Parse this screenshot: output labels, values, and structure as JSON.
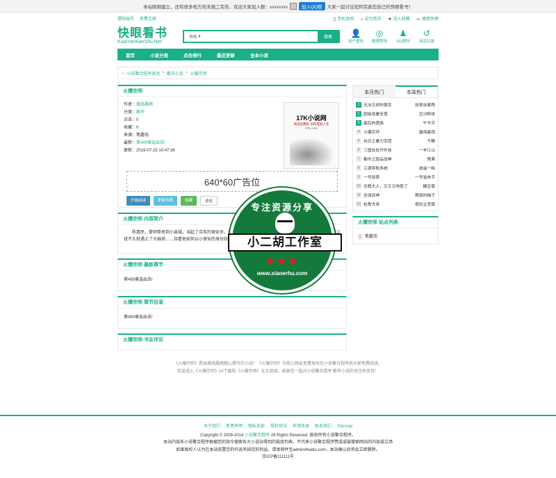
{
  "notice": {
    "text": "本站刚刚建立，还有很多地方尚未施工完毕，欢迎大家加入群：xxxxxxxx",
    "qq_button": "加入QQ群",
    "text2": "大家一起讨论如何完善您自己的快眼看书！"
  },
  "userbar": {
    "login": "登陆账号",
    "register": "免费注册",
    "mobile": "手机体验",
    "homepage": "设为首页",
    "favorite": "加入收藏",
    "desktop": "桌面快捷"
  },
  "logo": {
    "cn": "快眼看书",
    "en": "KuaiYanKanShu.Net"
  },
  "search": {
    "category": "书名",
    "button": "搜索",
    "value": ""
  },
  "header_icons": [
    {
      "icon": "user-icon",
      "glyph": "👤",
      "label": "用户登陆"
    },
    {
      "icon": "weibo-icon",
      "glyph": "◎",
      "label": "微博登陆"
    },
    {
      "icon": "qq-icon",
      "glyph": "♟",
      "label": "QQ登陆"
    },
    {
      "icon": "history-icon",
      "glyph": "↺",
      "label": "阅读记录"
    }
  ],
  "nav": [
    "首页",
    "小说分类",
    "点击排行",
    "最近更新",
    "全本小说"
  ],
  "breadcrumb": {
    "home": "小说聚合程序首页",
    "category": "都市小说",
    "book": "火爆宗师"
  },
  "book": {
    "title": "火爆宗师",
    "author_label": "作者：",
    "author": "瀚海晨雨",
    "category_label": "分类：",
    "category": "都市",
    "clicks_label": "点击：",
    "clicks": "0",
    "favorites_label": "收藏：",
    "favorites": "0",
    "source_label": "来源：",
    "source": "笔趣岛",
    "latest_label": "最新：",
    "latest": "第490章选出去!",
    "updated_label": "更新：",
    "updated": "2019-07-25 10:47:36",
    "cover": {
      "t1": "17K小说网",
      "t2": "阅读出精彩 创作成就人生",
      "t3": "17K.com"
    },
    "ad": "640*60广告位",
    "actions": [
      "开始阅读",
      "更新列表",
      "收藏",
      "评论"
    ]
  },
  "intro": {
    "title": "火爆宗师 内容简介",
    "text": "陈惠民，拳师牵来到小县城，当起了合库的保安员，想着每天混日子，无大亏损，本以为是个清闲的职务，不想上班不久就遇上了大麻烦……且看他如何以小保安的身份纷纷世间多彩……"
  },
  "latest_chapter": {
    "title": "火爆宗师 最新章节",
    "text": "第490章选出去!"
  },
  "chapter_list": {
    "title": "火爆宗师 章节目录",
    "text": "第490章选出去!"
  },
  "comments": {
    "title": "火爆宗师 书友评论"
  },
  "hot": {
    "tab_month": "本月热门",
    "tab_week": "本周热门",
    "items": [
      {
        "n": "1",
        "name": "无法忘却的誓恋",
        "author": "抚琴诉离殇"
      },
      {
        "n": "2",
        "name": "超级宠妻至尊",
        "author": "豆沙醉饼"
      },
      {
        "n": "3",
        "name": "最后的遗族",
        "author": "午木平"
      },
      {
        "n": "4",
        "name": "火爆宗师",
        "author": "瀚海晨雨"
      },
      {
        "n": "5",
        "name": "抗日之暴力军团",
        "author": "千鞭"
      },
      {
        "n": "6",
        "name": "三国处处开外挂",
        "author": "一丰江山"
      },
      {
        "n": "7",
        "name": "都市之超品战神",
        "author": "常果"
      },
      {
        "n": "8",
        "name": "江湖导航系统",
        "author": "逍遥一粕"
      },
      {
        "n": "9",
        "name": "一号狱首",
        "author": "一号狙击手"
      },
      {
        "n": "10",
        "name": "总裁大人，又又又吻我了",
        "author": "糖豆菊"
      },
      {
        "n": "11",
        "name": "全球武神",
        "author": "期滚的柚子"
      },
      {
        "n": "12",
        "name": "枯骨大帝",
        "author": "傍剑立苍蘖"
      }
    ]
  },
  "sites": {
    "title": "火爆宗师 站点列表",
    "items": [
      {
        "n": "1",
        "name": "笔趣岛"
      }
    ]
  },
  "description": {
    "line1": "《火爆宗师》是由瀚海晨雨精心撰写的小说！《火爆宗师》为热心网友免费发布在小说聚合程序供大家免费阅读。",
    "line2": "欢迎进入《火爆宗师》txt下载和《火爆宗师》全文阅读。谢谢您一直对小说聚合程序 都市小说的关注和支持！"
  },
  "footer": {
    "links": [
      "关于我们",
      "免责声明",
      "隐私条款",
      "授权协议",
      "申请收录",
      "联系我们",
      "Sitemap"
    ],
    "copyright_pre": "Copyright © 2009-2014",
    "copyright_site": "小说聚合程序",
    "copyright_post": "All Rights Reserved .版权所有小说聚合程序。",
    "line2": "本站内容系小说聚合程序根据您的指令搜索各大小说站得到的链接列表，不代表小说聚合程序赞成或被搜索网站的内容或立场",
    "line3": "如果版权人认为在本站放置您的作品有损您的利益，请发邮件至admin#baidu.com，本站确认后将会立即删除。",
    "icp": "京ICP备111111号"
  },
  "watermark": {
    "arc": "专注资源分享",
    "band": "小二胡工作室",
    "stars": "★★★",
    "url": "www.xiaoerhu.com"
  }
}
